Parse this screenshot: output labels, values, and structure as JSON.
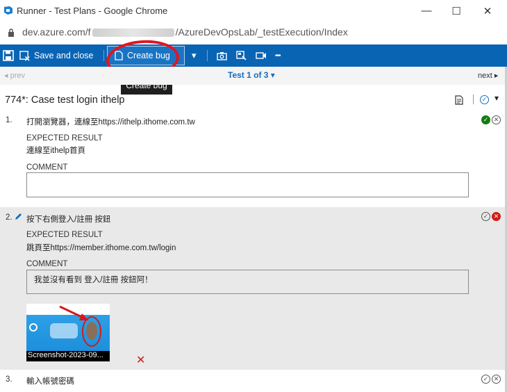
{
  "window": {
    "title": "Runner - Test Plans - Google Chrome",
    "minimize_glyph": "—",
    "maximize_glyph": "☐",
    "close_glyph": "✕"
  },
  "address": {
    "url_prefix": "dev.azure.com/f",
    "url_suffix": "/AzureDevOpsLab/_testExecution/Index"
  },
  "toolbar": {
    "save_close_label": "Save and close",
    "create_bug_label": "Create bug",
    "dropdown_glyph": "▾",
    "more_glyph": "•••",
    "colors": {
      "background": "#0a64b4",
      "annotation": "#e4141e"
    }
  },
  "tooltip": {
    "text": "Create bug"
  },
  "pager": {
    "prev_label": "prev",
    "test_label": "Test 1 of 3",
    "next_label": "next"
  },
  "case": {
    "title": "774*: Case test login ithelp"
  },
  "steps": [
    {
      "number": "1.",
      "action": "打開瀏覽器，連線至https://ithelp.ithome.com.tw",
      "expected_label": "EXPECTED RESULT",
      "expected": "連線至ithelp首頁",
      "comment_label": "COMMENT",
      "comment": "",
      "status": "passed"
    },
    {
      "number": "2.",
      "action": "按下右側登入/註冊 按鈕",
      "expected_label": "EXPECTED RESULT",
      "expected": "跳頁至https://member.ithome.com.tw/login",
      "comment_label": "COMMENT",
      "comment": "我並沒有看到 登入/註冊 按鈕阿！",
      "attachment": "Screenshot-2023-09...",
      "status": "failed"
    },
    {
      "number": "3.",
      "action": "輸入帳號密碼",
      "status": "none"
    }
  ]
}
